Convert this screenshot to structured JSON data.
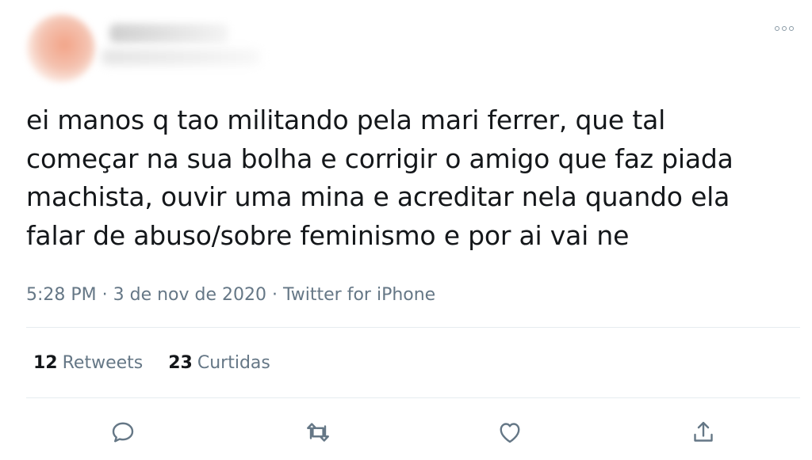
{
  "tweet": {
    "text_lines": [
      "ei manos q tao militando pela mari ferrer, que tal",
      "começar na sua bolha e corrigir o amigo que faz piada",
      "machista, ouvir uma mina e acreditar nela quando ela",
      "falar de abuso/sobre feminismo e por ai vai ne"
    ],
    "meta": "5:28 PM · 3 de nov de 2020 · Twitter for iPhone"
  },
  "stats": {
    "retweets_count": "12",
    "retweets_label": "Retweets",
    "likes_count": "23",
    "likes_label": "Curtidas"
  },
  "actions": {
    "reply_icon": "reply-icon",
    "retweet_icon": "retweet-icon",
    "like_icon": "heart-icon",
    "share_icon": "share-icon"
  },
  "colors": {
    "text": "#14171a",
    "secondary": "#657786",
    "divider": "#e6ecf0",
    "icon": "#657786"
  }
}
